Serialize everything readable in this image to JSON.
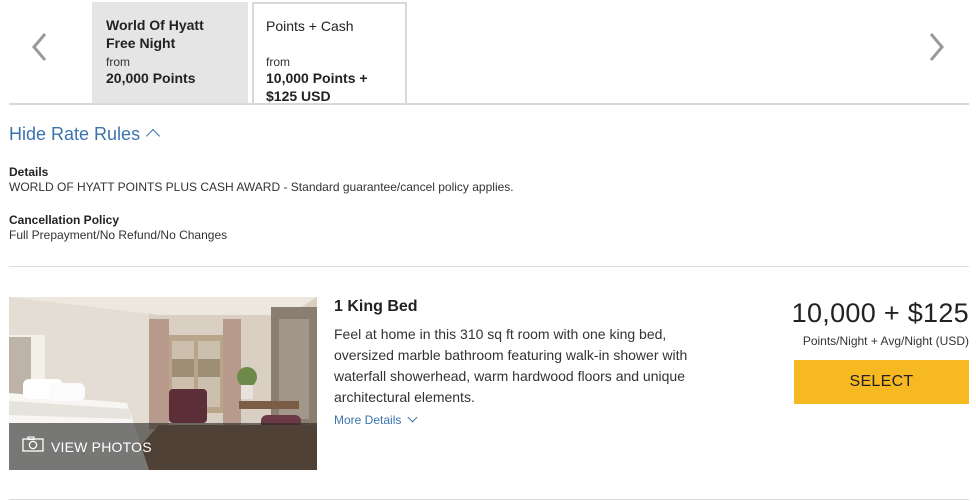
{
  "rate_tabs": [
    {
      "name": "World Of Hyatt Free Night",
      "from_label": "from",
      "price": "20,000 Points"
    },
    {
      "name": "Points + Cash",
      "from_label": "from",
      "price": "10,000 Points + $125 USD"
    }
  ],
  "nav": {
    "prev_icon": "chevron-left-icon",
    "next_icon": "chevron-right-icon"
  },
  "rate_rules": {
    "toggle_label": "Hide Rate Rules",
    "details_title": "Details",
    "details_text": "WORLD OF HYATT POINTS PLUS CASH AWARD - Standard guarantee/cancel policy applies.",
    "cancellation_title": "Cancellation Policy",
    "cancellation_text": "Full Prepayment/No Refund/No Changes"
  },
  "room": {
    "name": "1 King Bed",
    "description": "Feel at home in this 310 sq ft room with one king bed, oversized marble bathroom featuring walk-in shower with waterfall showerhead, warm hardwood floors and unique architectural elements.",
    "more_details_label": "More Details",
    "view_photos_label": "VIEW PHOTOS",
    "price": "10,000 + $125",
    "price_unit": "Points/Night + Avg/Night (USD)",
    "select_label": "SELECT"
  },
  "colors": {
    "accent_blue": "#3b74ad",
    "select_yellow": "#f6b921",
    "tab_active_bg": "#e5e5e5"
  }
}
